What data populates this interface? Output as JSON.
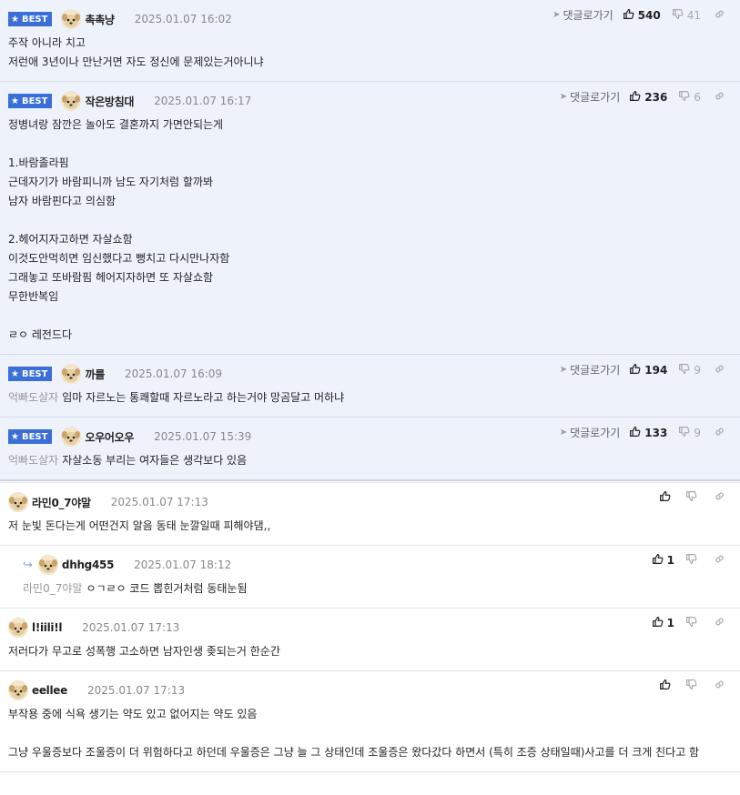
{
  "best_label": "BEST",
  "goto_label": "댓글로가기",
  "best_comments": [
    {
      "nick": "촉촉냥",
      "date": "2025.01.07 16:02",
      "up": "540",
      "down": "41",
      "mention": "",
      "lines": [
        "주작 아니라 치고",
        "저런애 3년이나 만난거면 자도 정신에 문제있는거아니냐"
      ]
    },
    {
      "nick": "작은방침대",
      "date": "2025.01.07 16:17",
      "up": "236",
      "down": "6",
      "mention": "",
      "lines": [
        "정병녀랑 잠깐은 놀아도 결혼까지 가면안되는게",
        "",
        "1.바람졸라핌",
        "근데자기가 바람피니까 남도 자기처럼 할까봐",
        "남자 바람핀다고 의심함",
        "",
        "2.헤어지자고하면 자살쇼함",
        "이것도안먹히면 임신했다고 뻥치고 다시만나자함",
        "그래놓고 또바람핌 헤어지자하면 또 자살쇼함",
        "무한반복임",
        "",
        "ㄹㅇ 레전드다"
      ]
    },
    {
      "nick": "까를",
      "date": "2025.01.07 16:09",
      "up": "194",
      "down": "9",
      "mention": "억빠도살자",
      "lines": [
        "임마 자르노는 통쾌할때 자르노라고 하는거야 망곰달고 머하냐"
      ]
    },
    {
      "nick": "오우어오우",
      "date": "2025.01.07 15:39",
      "up": "133",
      "down": "9",
      "mention": "억빠도살자",
      "lines": [
        "자살소동 부리는 여자들은 생각보다 있음"
      ]
    }
  ],
  "comments": [
    {
      "nick": "라민0_7야말",
      "date": "2025.01.07 17:13",
      "up": "",
      "reply": false,
      "mention": "",
      "lines": [
        "저 눈빛 돈다는게 어떤건지 알음 동태 눈깔일때 피해야댐,,"
      ]
    },
    {
      "nick": "dhhg455",
      "date": "2025.01.07 18:12",
      "up": "1",
      "reply": true,
      "mention": "라민0_7야말",
      "lines": [
        "ㅇㄱㄹㅇ 코드 뽑힌거처럼 동태눈됨"
      ]
    },
    {
      "nick": "l!iili!l",
      "date": "2025.01.07 17:13",
      "up": "1",
      "reply": false,
      "mention": "",
      "lines": [
        "저러다가 무고로 성폭행 고소하면 남자인생 좆되는거 한순간"
      ]
    },
    {
      "nick": "eellee",
      "date": "2025.01.07 17:13",
      "up": "",
      "reply": false,
      "mention": "",
      "lines": [
        "부작용 중에 식욕 생기는 약도 있고 없어지는 약도 있음",
        "",
        "그냥 우울증보다 조울증이 더 위험하다고 하던데 우울증은 그냥 늘 그 상태인데 조울증은 왔다갔다 하면서 (특히 조증 상태일때)사고를 더 크게 친다고 함"
      ]
    }
  ],
  "colors": {
    "best_bg": "#eef2fb",
    "badge": "#3b6fd8"
  }
}
